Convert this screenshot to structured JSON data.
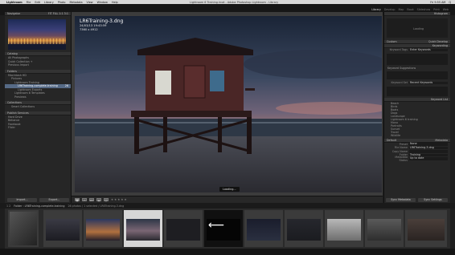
{
  "menubar": {
    "apple": "",
    "app": "Lightroom",
    "menus": [
      "File",
      "Edit",
      "Library",
      "Photo",
      "Metadata",
      "View",
      "Window",
      "Help"
    ],
    "window_title": "Lightroom 6 Training.lrcat - Adobe Photoshop Lightroom - Library",
    "right_items": [
      "Fri 9:55 AM",
      "Q"
    ]
  },
  "modules": [
    "Library",
    "Develop",
    "Map",
    "Book",
    "Slideshow",
    "Print",
    "Web"
  ],
  "left_panel": {
    "navigator": {
      "title": "Navigator",
      "zoom": "FIT  FILL  1:1  3:1"
    },
    "catalog": {
      "title": "Catalog",
      "items": [
        {
          "label": "All Photographs",
          "count": ""
        },
        {
          "label": "Quick Collection +",
          "count": ""
        },
        {
          "label": "Previous Import",
          "count": ""
        }
      ]
    },
    "folders": {
      "title": "Folders",
      "items": [
        {
          "label": "Macintosh HD",
          "count": "",
          "level": 0,
          "selected": false
        },
        {
          "label": "Pictures",
          "count": "",
          "level": 1,
          "selected": false
        },
        {
          "label": "Lightroom Training",
          "count": "",
          "level": 2,
          "selected": false
        },
        {
          "label": "LR6Training-complete-training",
          "count": "26",
          "level": 3,
          "selected": true
        },
        {
          "label": "Lightroom Exports",
          "count": "",
          "level": 3,
          "selected": false
        },
        {
          "label": "Lightroom 6 Templates",
          "count": "",
          "level": 2,
          "selected": false
        },
        {
          "label": "Previews",
          "count": "",
          "level": 2,
          "selected": false
        }
      ]
    },
    "collections": {
      "title": "Collections",
      "items": [
        {
          "label": "Smart Collections",
          "count": ""
        }
      ]
    },
    "publish": {
      "title": "Publish Services",
      "items": [
        {
          "label": "Hard Drive",
          "count": ""
        },
        {
          "label": "Behance",
          "count": ""
        },
        {
          "label": "Facebook",
          "count": ""
        },
        {
          "label": "Flickr",
          "count": ""
        }
      ]
    },
    "buttons": {
      "import": "Import...",
      "export": "Export..."
    }
  },
  "center": {
    "filename": "LR6Training-3.dng",
    "datetime": "24/03/13 19:43:59",
    "dimensions": "7360 x 4912",
    "loading": "Loading..."
  },
  "toolbar": {
    "view_buttons": [
      "▦",
      "▭",
      "XY",
      "▤",
      "☺"
    ],
    "stars": "★ ★ ★ ★ ★"
  },
  "right_panel": {
    "histogram": {
      "title": "Histogram",
      "label": "Loading"
    },
    "quick_develop": {
      "title": "Quick Develop",
      "preset": "Custom"
    },
    "keywording": {
      "title": "Keywording",
      "tags_label": "Keyword Tags",
      "tags_value": "Enter Keywords",
      "suggestions": "Keyword Suggestions",
      "set_label": "Keyword Set",
      "set_value": "Recent Keywords"
    },
    "keyword_list": {
      "title": "Keyword List",
      "items": [
        "Beach",
        "Birds",
        "Boats",
        "Dogs",
        "Landscape",
        "Lightroom 6 training",
        "Mono",
        "Portraits",
        "Sunset",
        "Travel",
        "Wildlife"
      ]
    },
    "metadata": {
      "title": "Metadata",
      "preset": "Default",
      "fields": [
        {
          "k": "Preset",
          "v": "None"
        },
        {
          "k": "File Name",
          "v": "LR6Training-3.dng"
        },
        {
          "k": "Copy Name",
          "v": ""
        },
        {
          "k": "Folder",
          "v": "Training"
        },
        {
          "k": "Metadata Status",
          "v": "Up to date"
        }
      ]
    },
    "buttons": {
      "sync": "Sync Metadata",
      "sync_settings": "Sync Settings"
    }
  },
  "filmstrip_bar": {
    "pages": "1  2",
    "path": "Folder : LR6Training-complete-training",
    "counts": "26 photos / 1 selected / LR6Training-3.dng"
  },
  "filmstrip": {
    "thumbs": [
      {
        "name": "thumb-bridge",
        "selected": false,
        "tone": "#4a4a4a"
      },
      {
        "name": "thumb-dusk",
        "selected": false,
        "tone": "#2a2a2a"
      },
      {
        "name": "thumb-city",
        "selected": false,
        "tone": "#8a5a3a"
      },
      {
        "name": "thumb-lifeguard",
        "selected": true,
        "tone": "#2c2c34"
      },
      {
        "name": "thumb-dark",
        "selected": false,
        "tone": "#222"
      },
      {
        "name": "thumb-arrow",
        "selected": false,
        "tone": "#0a0a0a"
      },
      {
        "name": "thumb-night",
        "selected": false,
        "tone": "#1e2130"
      },
      {
        "name": "thumb-sea",
        "selected": false,
        "tone": "#25262b"
      },
      {
        "name": "thumb-snow",
        "selected": false,
        "tone": "#9a9a9a"
      },
      {
        "name": "thumb-pier",
        "selected": false,
        "tone": "#4a4a4a"
      },
      {
        "name": "thumb-stone",
        "selected": false,
        "tone": "#3a3330"
      }
    ]
  }
}
